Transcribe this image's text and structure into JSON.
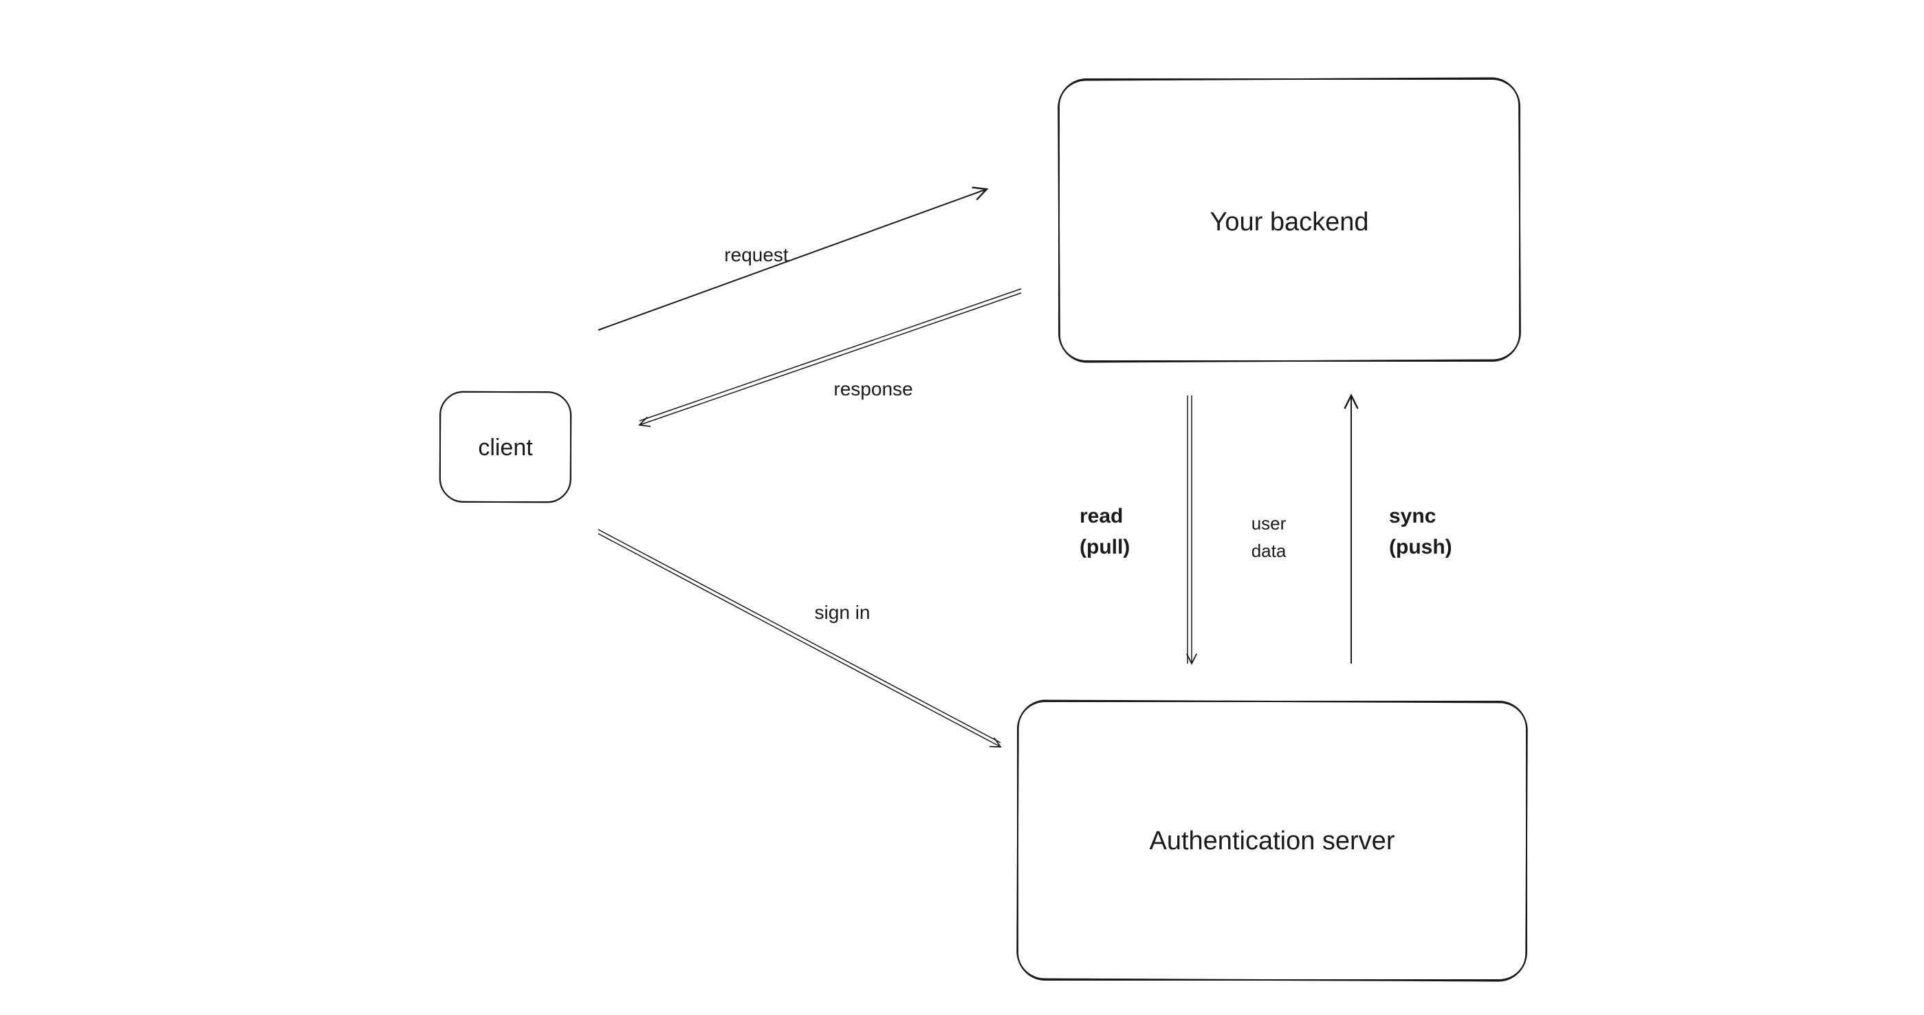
{
  "nodes": {
    "client": {
      "label": "client"
    },
    "backend": {
      "label": "Your backend"
    },
    "auth": {
      "label": "Authentication server"
    }
  },
  "edges": {
    "request": {
      "label": "request"
    },
    "response": {
      "label": "response"
    },
    "signin": {
      "label": "sign in"
    },
    "read_pull_l1": "read",
    "read_pull_l2": "(pull)",
    "user_data_l1": "user",
    "user_data_l2": "data",
    "sync_push_l1": "sync",
    "sync_push_l2": "(push)"
  }
}
